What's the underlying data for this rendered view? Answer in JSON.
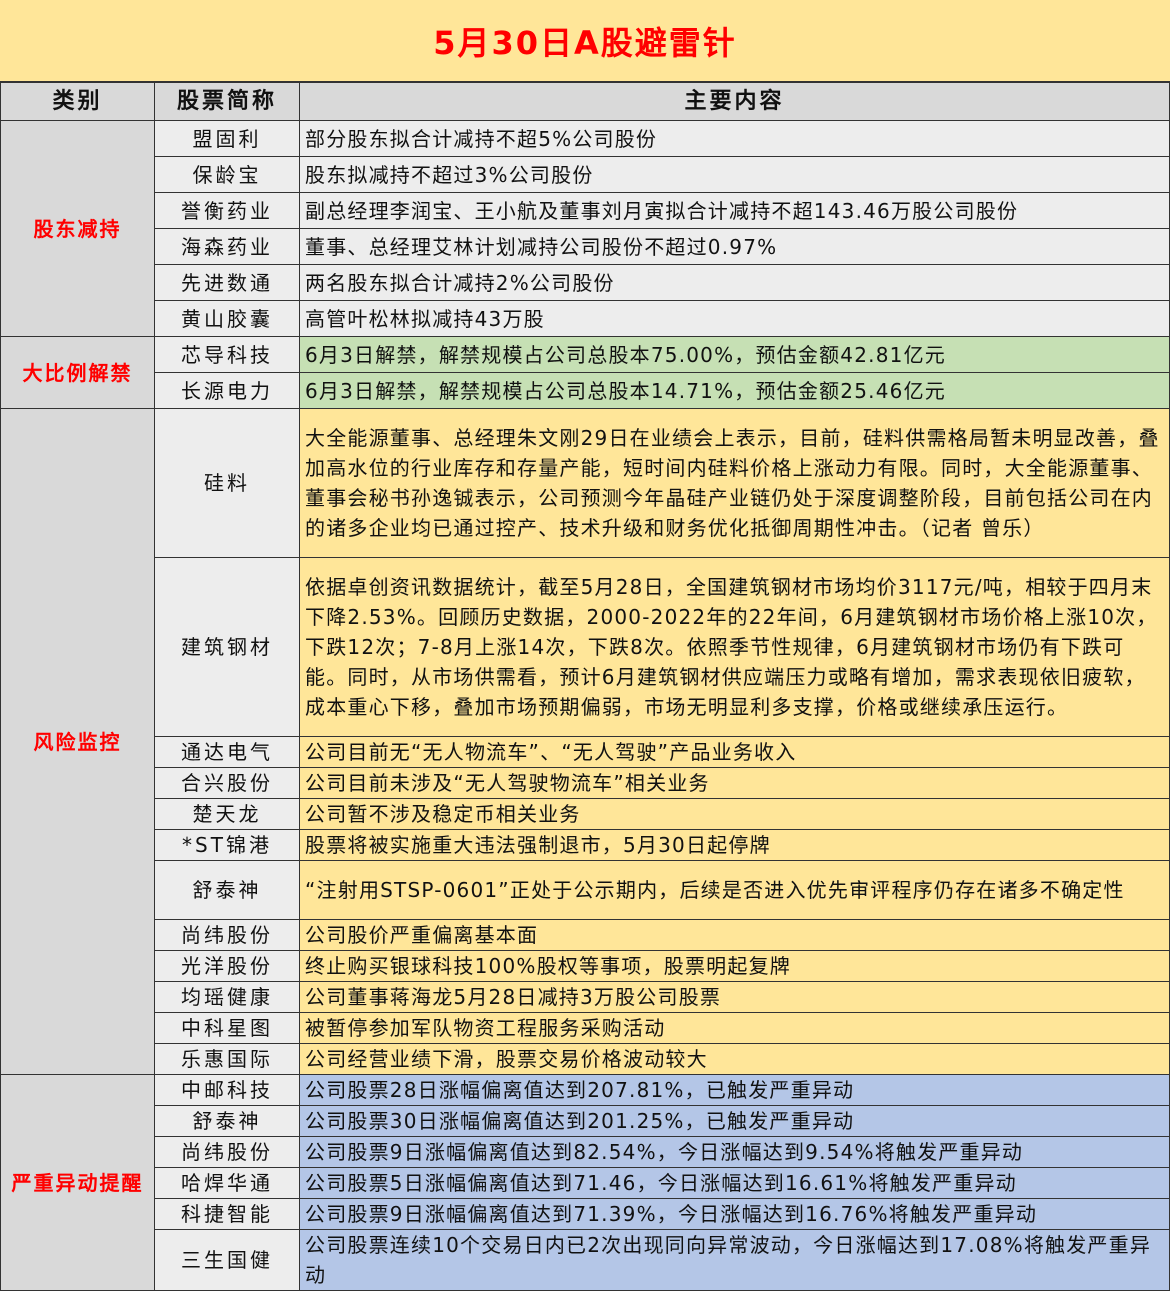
{
  "title": "5月30日A股避雷针",
  "headers": {
    "category": "类别",
    "name": "股票简称",
    "content": "主要内容"
  },
  "colors": {
    "title_bg": "#ffe699",
    "title_text": "#ff0000",
    "gray": "#ededed",
    "green": "#c6e0b4",
    "yellow": "#ffe699",
    "blue": "#b4c6e7"
  },
  "groups": [
    {
      "category": "股东减持",
      "tone": "gray",
      "rows": [
        {
          "name": "盟固利",
          "content": "部分股东拟合计减持不超5%公司股份",
          "h": 37
        },
        {
          "name": "保龄宝",
          "content": "股东拟减持不超过3%公司股份",
          "h": 37
        },
        {
          "name": "誉衡药业",
          "content": "副总经理李润宝、王小航及董事刘月寅拟合计减持不超143.46万股公司股份",
          "h": 37
        },
        {
          "name": "海森药业",
          "content": "董事、总经理艾林计划减持公司股份不超过0.97%",
          "h": 37
        },
        {
          "name": "先进数通",
          "content": "两名股东拟合计减持2%公司股份",
          "h": 37
        },
        {
          "name": "黄山胶囊",
          "content": "高管叶松林拟减持43万股",
          "h": 37
        }
      ]
    },
    {
      "category": "大比例解禁",
      "tone": "green",
      "rows": [
        {
          "name": "芯导科技",
          "content": "6月3日解禁，解禁规模占公司总股本75.00%，预估金额42.81亿元",
          "h": 37
        },
        {
          "name": "长源电力",
          "content": "6月3日解禁，解禁规模占公司总股本14.71%，预估金额25.46亿元",
          "h": 37
        }
      ]
    },
    {
      "category": "风险监控",
      "tone": "yellow",
      "rows": [
        {
          "name": "硅料",
          "content": "大全能源董事、总经理朱文刚29日在业绩会上表示，目前，硅料供需格局暂未明显改善，叠加高水位的行业库存和存量产能，短时间内硅料价格上涨动力有限。同时，大全能源董事、董事会秘书孙逸铖表示，公司预测今年晶硅产业链仍处于深度调整阶段，目前包括公司在内的诸多企业均已通过控产、技术升级和财务优化抵御周期性冲击。（记者 曾乐）",
          "h": 150
        },
        {
          "name": "建筑钢材",
          "content": "依据卓创资讯数据统计，截至5月28日，全国建筑钢材市场均价3117元/吨，相较于四月末下降2.53%。回顾历史数据，2000-2022年的22年间，6月建筑钢材市场价格上涨10次，下跌12次；7-8月上涨14次，下跌8次。依照季节性规律，6月建筑钢材市场仍有下跌可能。同时，从市场供需看，预计6月建筑钢材供应端压力或略有增加，需求表现依旧疲软，成本重心下移，叠加市场预期偏弱，市场无明显利多支撑，价格或继续承压运行。",
          "h": 180
        },
        {
          "name": "通达电气",
          "content": "公司目前无“无人物流车”、“无人驾驶”产品业务收入",
          "h": 30
        },
        {
          "name": "合兴股份",
          "content": "公司目前未涉及“无人驾驶物流车”相关业务",
          "h": 30
        },
        {
          "name": "楚天龙",
          "content": "公司暂不涉及稳定币相关业务",
          "h": 30
        },
        {
          "name": "*ST锦港",
          "content": "股票将被实施重大违法强制退市，5月30日起停牌",
          "h": 30
        },
        {
          "name": "舒泰神",
          "content": "“注射用STSP-0601”正处于公示期内，后续是否进入优先审评程序仍存在诸多不确定性",
          "h": 60
        },
        {
          "name": "尚纬股份",
          "content": "公司股价严重偏离基本面",
          "h": 30
        },
        {
          "name": "光洋股份",
          "content": "终止购买银球科技100%股权等事项，股票明起复牌",
          "h": 30
        },
        {
          "name": "均瑶健康",
          "content": "公司董事蒋海龙5月28日减持3万股公司股票",
          "h": 30
        },
        {
          "name": "中科星图",
          "content": "被暂停参加军队物资工程服务采购活动",
          "h": 30
        },
        {
          "name": "乐惠国际",
          "content": "公司经营业绩下滑，股票交易价格波动较大",
          "h": 30
        }
      ]
    },
    {
      "category": "严重异动提醒",
      "tone": "blue",
      "rows": [
        {
          "name": "中邮科技",
          "content": "公司股票28日涨幅偏离值达到207.81%，已触发严重异动",
          "h": 31
        },
        {
          "name": "舒泰神",
          "content": "公司股票30日涨幅偏离值达到201.25%，已触发严重异动",
          "h": 31
        },
        {
          "name": "尚纬股份",
          "content": "公司股票9日涨幅偏离值达到82.54%，今日涨幅达到9.54%将触发严重异动",
          "h": 31
        },
        {
          "name": "哈焊华通",
          "content": "公司股票5日涨幅偏离值达到71.46，今日涨幅达到16.61%将触发严重异动",
          "h": 31
        },
        {
          "name": "科捷智能",
          "content": "公司股票9日涨幅偏离值达到71.39%，今日涨幅达到16.76%将触发严重异动",
          "h": 31
        },
        {
          "name": "三生国健",
          "content": "公司股票连续10个交易日内已2次出现同向异常波动，今日涨幅达到17.08%将触发严重异动",
          "h": 60
        }
      ]
    }
  ]
}
